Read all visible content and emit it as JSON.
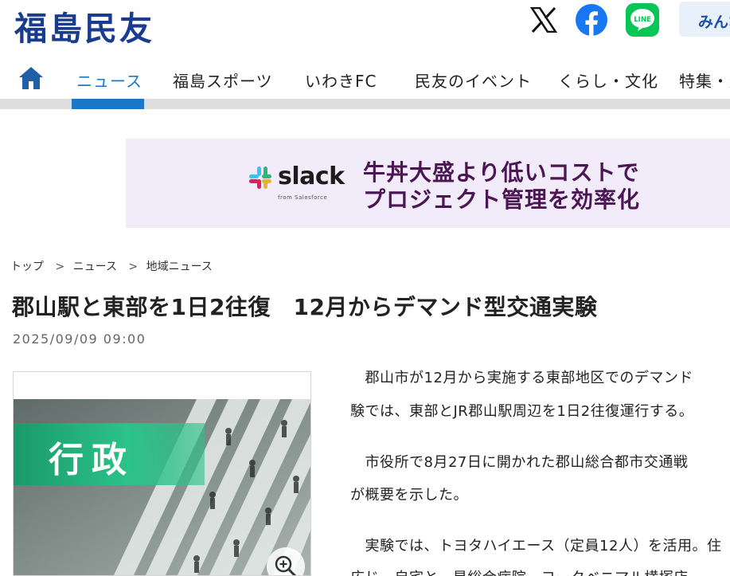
{
  "site": {
    "logo_text": "福島民友",
    "minna_label": "みんな"
  },
  "social": {
    "x_icon": "x-logo-icon",
    "facebook_icon": "facebook-icon",
    "line_icon": "line-icon",
    "line_label": "LINE"
  },
  "nav": {
    "home_icon": "home-icon",
    "items": [
      {
        "label": "ニュース",
        "active": true
      },
      {
        "label": "福島スポーツ"
      },
      {
        "label": "いわきFC"
      },
      {
        "label": "民友のイベント"
      },
      {
        "label": "くらし・文化"
      },
      {
        "label": "特集・連"
      }
    ],
    "active_color": "#1b78c8"
  },
  "ad": {
    "brand": "slack",
    "brand_sub": "from Salesforce",
    "headline_line1": "牛丼大盛より低いコストで",
    "headline_line2": "プロジェクト管理を効率化"
  },
  "breadcrumb": {
    "items": [
      "トップ",
      "ニュース",
      "地域ニュース"
    ],
    "separator": ">"
  },
  "article": {
    "title": "郡山駅と東部を1日2往復　12月からデマンド型交通実験",
    "date": "2025/09/09 09:00",
    "image_category": "行政",
    "zoom_icon": "zoom-in-icon",
    "paragraphs": [
      "　郡山市が12月から実施する東部地区でのデマンド",
      "験では、東部とJR郡山駅周辺を1日2往復運行する。",
      "　市役所で8月27日に開かれた郡山総合都市交通戦",
      "が概要を示した。",
      "　実験では、トヨタハイエース（定員12人）を活用。住",
      "広じ、自宅と、星総合病院、ヨークベニマル横塚店"
    ]
  }
}
